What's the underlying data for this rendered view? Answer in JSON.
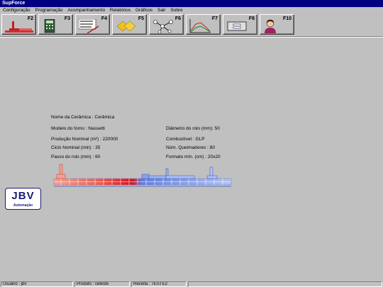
{
  "window": {
    "title": "SupForce"
  },
  "menu": [
    "Configuração",
    "Programação",
    "Acompanhamento",
    "Relatórios",
    "Gráficos",
    "Sair",
    "Sobre"
  ],
  "toolbar": [
    {
      "key": "F2",
      "icon": "kiln-icon"
    },
    {
      "key": "F3",
      "icon": "calculator-icon"
    },
    {
      "key": "F4",
      "icon": "parameters-icon"
    },
    {
      "key": "F5",
      "icon": "tiles-icon"
    },
    {
      "key": "F6",
      "icon": "network-icon"
    },
    {
      "key": "F7",
      "icon": "line-chart-icon"
    },
    {
      "key": "F8",
      "icon": "device-icon"
    },
    {
      "key": "F10",
      "icon": "user-icon"
    }
  ],
  "info": {
    "nome": "Nome da Cerâmica : Cerâmica",
    "modelo": "Modelo do forno : Nassetti",
    "producao": "Produção Nominal (m²) : 220000",
    "ciclo": "Ciclo Nominal (min) : 35",
    "passo": "Passo do rolo (mm) : 60",
    "diametro": "Diâmetro do rolo (mm): 50",
    "combustivel": "Combustível : GLP",
    "queimadores": "Núm. Queimadores : 80",
    "formato": "Formato mín. (cm) : 20x20"
  },
  "logo": {
    "name": "JBV",
    "tagline": "Automação"
  },
  "status": {
    "usuario": "Usuário : jbv",
    "produto": "Produto : celeste",
    "receita": "Receita : TESTE2"
  },
  "colors": {
    "titlebar": "#000080",
    "background": "#c0c0c0",
    "kiln_hot": "#e03030",
    "kiln_cool": "#4060d0"
  }
}
